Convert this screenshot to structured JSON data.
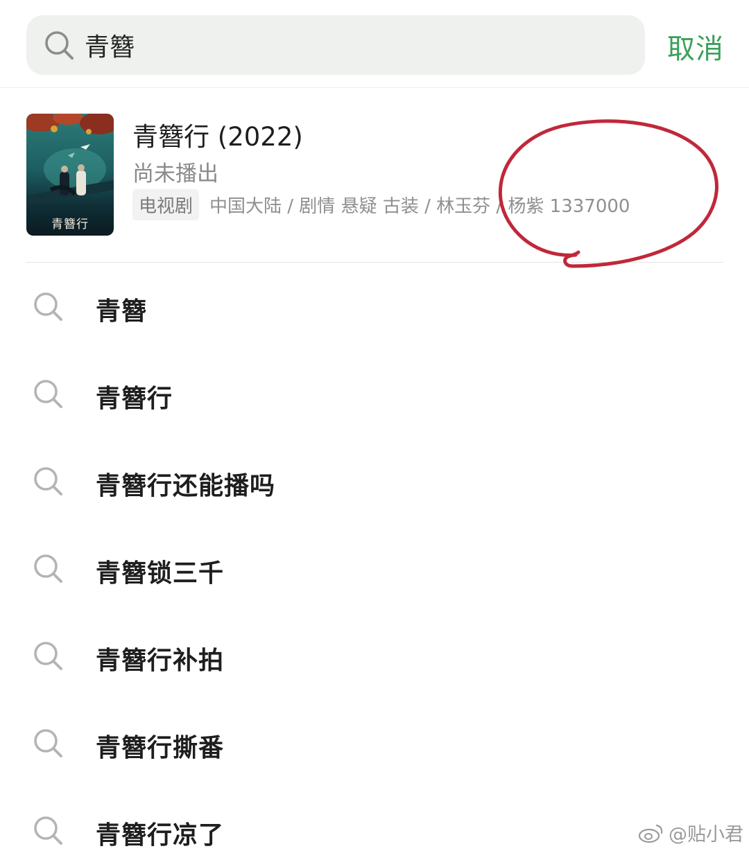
{
  "search": {
    "query": "青簪",
    "cancel_label": "取消"
  },
  "movie": {
    "title": "青簪行 (2022)",
    "status": "尚未播出",
    "type": "电视剧",
    "meta": "中国大陆 / 剧情 悬疑 古装 / 林玉芬 / 杨紫 1337000",
    "poster_caption": "青簪行",
    "annotation_color": "#c0283a"
  },
  "suggestions": [
    {
      "label": "青簪"
    },
    {
      "label": "青簪行"
    },
    {
      "label": "青簪行还能播吗"
    },
    {
      "label": "青簪锁三千"
    },
    {
      "label": "青簪行补拍"
    },
    {
      "label": "青簪行撕番"
    },
    {
      "label": "青簪行凉了"
    }
  ],
  "watermark": "@贴小君",
  "colors": {
    "accent": "#3aa05a",
    "search_bg": "#eef1ee"
  }
}
